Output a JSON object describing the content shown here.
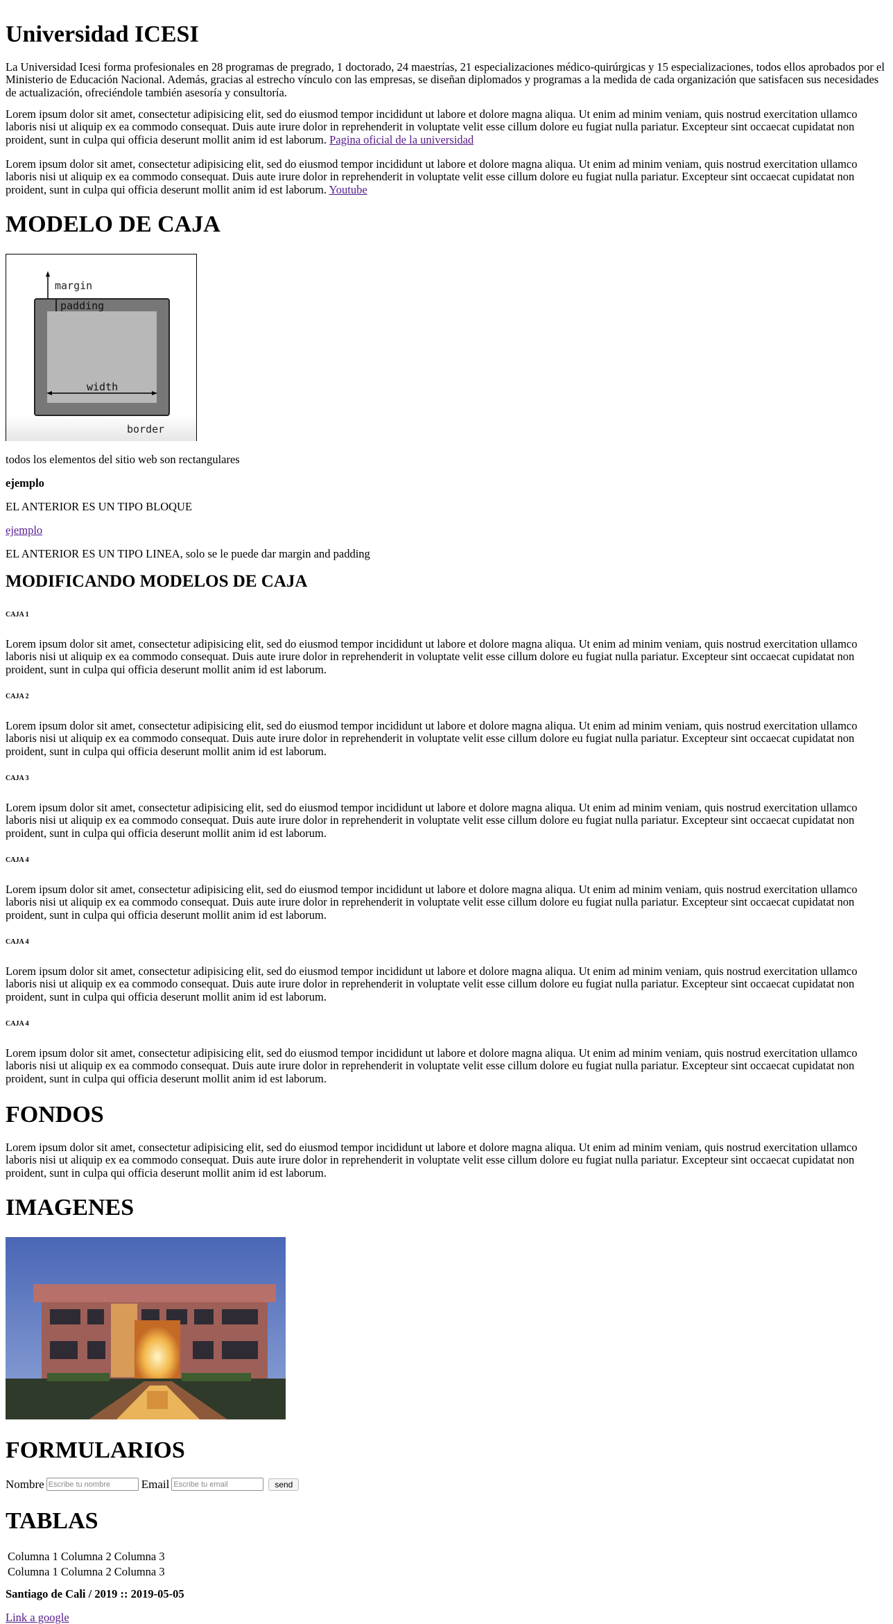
{
  "header": {
    "title": "Universidad ICESI",
    "intro": "La Universidad Icesi forma profesionales en 28 programas de pregrado, 1 doctorado, 24 maestrías, 21 especializaciones médico-quirúrgicas y 15 especializaciones, todos ellos aprobados por el Ministerio de Educación Nacional. Además, gracias al estrecho vínculo con las empresas, se diseñan diplomados y programas a la medida de cada organización que satisfacen sus necesidades de actualización, ofreciéndole también asesoría y consultoría."
  },
  "lorem": "Lorem ipsum dolor sit amet, consectetur adipisicing elit, sed do eiusmod tempor incididunt ut labore et dolore magna aliqua. Ut enim ad minim veniam, quis nostrud exercitation ullamco laboris nisi ut aliquip ex ea commodo consequat. Duis aute irure dolor in reprehenderit in voluptate velit esse cillum dolore eu fugiat nulla pariatur. Excepteur sint occaecat cupidatat non proident, sunt in culpa qui officia deserunt mollit anim id est laborum.",
  "links": {
    "official": "Pagina oficial de la universidad",
    "youtube": "Youtube",
    "ejemplo": "ejemplo",
    "google": "Link a google"
  },
  "box_model": {
    "heading": "MODELO DE CAJA",
    "diagram": {
      "margin": "margin",
      "padding": "padding",
      "width": "width",
      "border": "border"
    },
    "rect_text": "todos los elementos del sitio web son rectangulares",
    "bold_example": "ejemplo",
    "block_note": "EL ANTERIOR ES UN TIPO BLOQUE",
    "inline_note": "EL ANTERIOR ES UN TIPO LINEA, solo se le puede dar margin and padding"
  },
  "modifying": {
    "heading": "MODIFICANDO MODELOS DE CAJA",
    "boxes": [
      "CAJA 1",
      "CAJA 2",
      "CAJA 3",
      "CAJA 4",
      "CAJA 4",
      "CAJA 4"
    ]
  },
  "fondos": {
    "heading": "FONDOS"
  },
  "imagenes": {
    "heading": "IMAGENES"
  },
  "form": {
    "heading": "FORMULARIOS",
    "name_label": "Nombre",
    "name_placeholder": "Escribe tu nombre",
    "email_label": "Email",
    "email_placeholder": "Escribe tu email",
    "send_label": "send"
  },
  "tables": {
    "heading": "TABLAS",
    "rows": [
      [
        "Columna 1",
        "Columna 2",
        "Columna 3"
      ],
      [
        "Columna 1",
        "Columna 2",
        "Columna 3"
      ]
    ]
  },
  "footer": {
    "text": "Santiago de Cali / 2019 :: 2019-05-05"
  }
}
